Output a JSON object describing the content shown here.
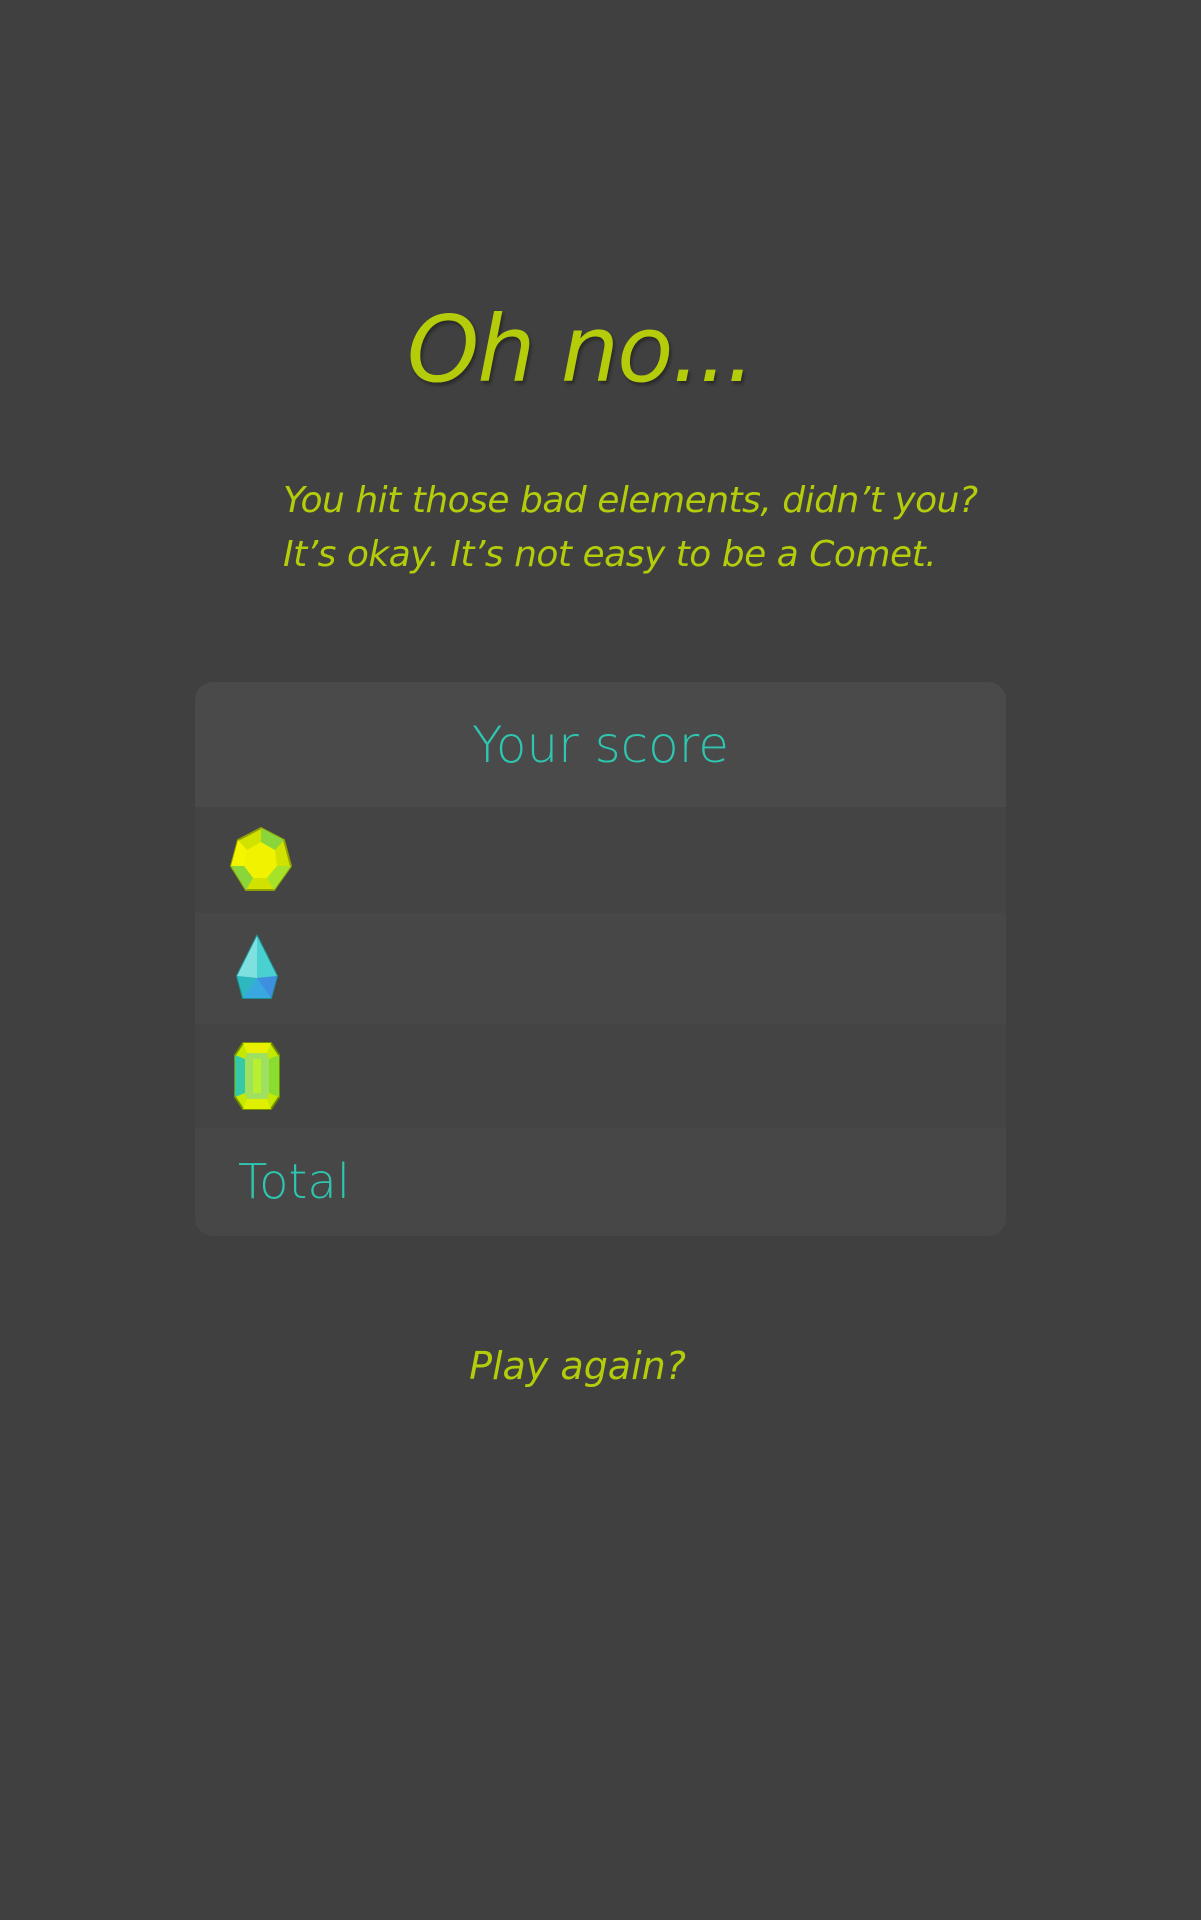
{
  "title": "Oh no...",
  "subtitle": {
    "line1": "You hit those bad elements, didn’t you?",
    "line2": "It’s okay. It’s not easy to be a Comet."
  },
  "score_panel": {
    "heading": "Your score",
    "rows": [
      {
        "icon": "yellow-green-gem-icon"
      },
      {
        "icon": "cyan-crystal-icon"
      },
      {
        "icon": "green-emerald-icon"
      }
    ],
    "total_label": "Total"
  },
  "play_again": "Play again?",
  "colors": {
    "background": "#404040",
    "accent_yellow": "#b4cc0a",
    "accent_teal": "#2ec6b0"
  }
}
